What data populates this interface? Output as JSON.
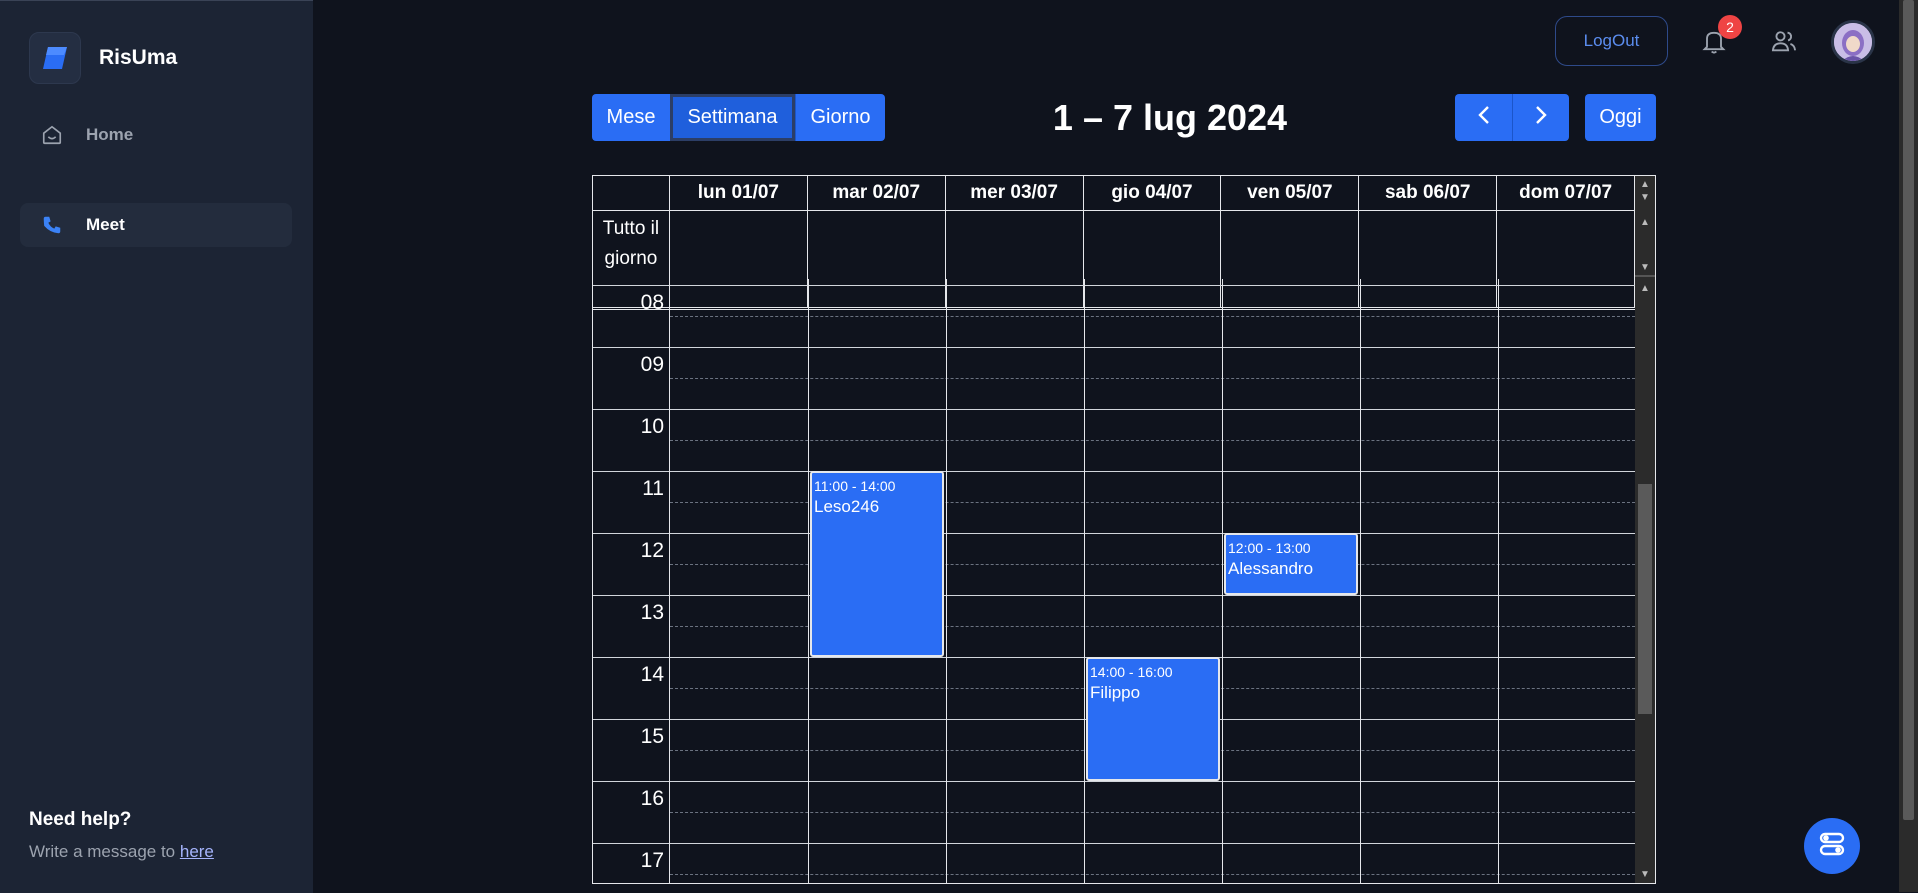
{
  "brand": {
    "name": "RisUma"
  },
  "sidebar": {
    "items": [
      {
        "label": "Home",
        "icon": "home-icon"
      },
      {
        "label": "Meet",
        "icon": "phone-icon",
        "active": true
      }
    ],
    "help_title": "Need help?",
    "help_text": "Write a message to ",
    "help_link": "here"
  },
  "header": {
    "logout_label": "LogOut",
    "notifications_count": "2"
  },
  "toolbar": {
    "views": [
      "Mese",
      "Settimana",
      "Giorno"
    ],
    "active_view": "Settimana",
    "title": "1 – 7 lug 2024",
    "today_label": "Oggi"
  },
  "calendar": {
    "days": [
      "lun 01/07",
      "mar 02/07",
      "mer 03/07",
      "gio 04/07",
      "ven 05/07",
      "sab 06/07",
      "dom 07/07"
    ],
    "allday_label": "Tutto il giorno",
    "hours": [
      "08",
      "09",
      "10",
      "11",
      "12",
      "13",
      "14",
      "15",
      "16",
      "17"
    ],
    "events": [
      {
        "day": 1,
        "start": 11,
        "end": 14,
        "time": "11:00 - 14:00",
        "name": "Leso246"
      },
      {
        "day": 4,
        "start": 12,
        "end": 13,
        "time": "12:00 - 13:00",
        "name": "Alessandro"
      },
      {
        "day": 3,
        "start": 14,
        "end": 16,
        "time": "14:00 - 16:00",
        "name": "Filippo"
      }
    ]
  },
  "colors": {
    "accent": "#2a6df4",
    "background": "#0f131d",
    "sidebar": "#1c2434"
  }
}
